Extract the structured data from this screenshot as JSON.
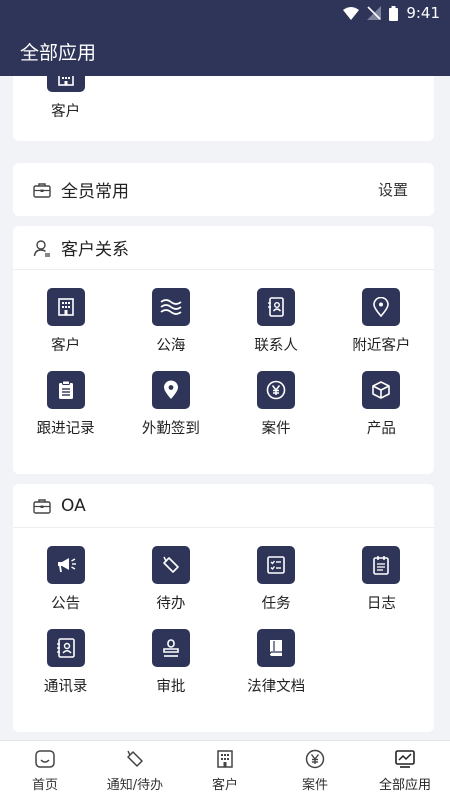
{
  "status": {
    "time": "9:41"
  },
  "appbar": {
    "title": "全部应用"
  },
  "top_partial": {
    "items": [
      {
        "label": "客户",
        "icon": "building-icon"
      }
    ]
  },
  "common": {
    "title": "全员常用",
    "settings_label": "设置"
  },
  "customer_relations": {
    "title": "客户关系",
    "items": [
      {
        "label": "客户",
        "icon": "building-icon"
      },
      {
        "label": "公海",
        "icon": "waves-icon"
      },
      {
        "label": "联系人",
        "icon": "contact-book-icon"
      },
      {
        "label": "附近客户",
        "icon": "location-pin-icon"
      },
      {
        "label": "跟进记录",
        "icon": "clipboard-icon"
      },
      {
        "label": "外勤签到",
        "icon": "location-pin-icon"
      },
      {
        "label": "案件",
        "icon": "yen-coin-icon"
      },
      {
        "label": "产品",
        "icon": "box-icon"
      }
    ]
  },
  "oa": {
    "title": "OA",
    "items": [
      {
        "label": "公告",
        "icon": "megaphone-icon"
      },
      {
        "label": "待办",
        "icon": "tag-icon"
      },
      {
        "label": "任务",
        "icon": "checklist-icon"
      },
      {
        "label": "日志",
        "icon": "calendar-notes-icon"
      },
      {
        "label": "通讯录",
        "icon": "contact-card-icon"
      },
      {
        "label": "审批",
        "icon": "stamp-icon"
      },
      {
        "label": "法律文档",
        "icon": "book-icon"
      }
    ]
  },
  "tabbar": {
    "items": [
      {
        "label": "首页",
        "icon": "home-icon"
      },
      {
        "label": "通知/待办",
        "icon": "tag-icon"
      },
      {
        "label": "客户",
        "icon": "building-icon"
      },
      {
        "label": "案件",
        "icon": "yen-coin-icon"
      },
      {
        "label": "全部应用",
        "icon": "apps-monitor-icon"
      }
    ]
  },
  "colors": {
    "primary": "#2e3558",
    "background": "#f2f3f7"
  }
}
